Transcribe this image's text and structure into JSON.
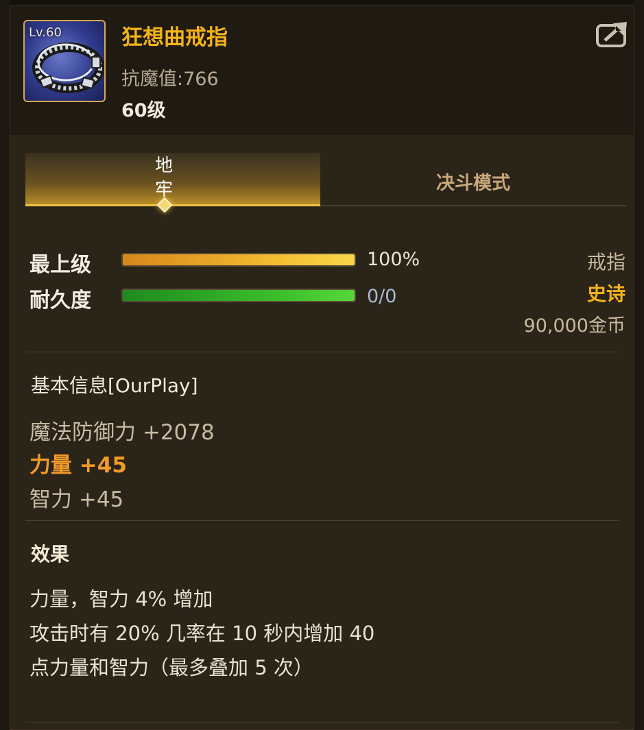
{
  "item": {
    "level_badge": "Lv.60",
    "name": "狂想曲戒指",
    "magic_resistance": "抗魔值:766",
    "level": "60级",
    "icon": "ring-icon"
  },
  "share_icon": "share-icon",
  "tabs": [
    {
      "label": "地牢",
      "active": true
    },
    {
      "label": "决斗模式",
      "active": false
    }
  ],
  "stats": {
    "grade": {
      "label": "最上级",
      "value": "100%",
      "fill": 1.0,
      "color": "#f4c133"
    },
    "durability": {
      "label": "耐久度",
      "value": "0/0",
      "fill": 1.0,
      "color": "#3cc12c"
    }
  },
  "item_info": {
    "type": "戒指",
    "rarity": "史诗",
    "price": "90,000金币"
  },
  "basic_info": {
    "title": "基本信息[OurPlay]",
    "attributes": [
      {
        "text": "魔法防御力 +2078",
        "color": "#c8bba3"
      },
      {
        "text": "力量 +45",
        "color": "#f19a2a"
      },
      {
        "text": "智力 +45",
        "color": "#c8bba3"
      }
    ]
  },
  "effects": {
    "title": "效果",
    "lines": [
      "力量，智力 4% 增加",
      "攻击时有 20% 几率在 10 秒内增加 40",
      "点力量和智力（最多叠加 5 次）"
    ]
  },
  "colors": {
    "accent": "#f4b31a",
    "rarity_epic": "#f4b31a"
  }
}
